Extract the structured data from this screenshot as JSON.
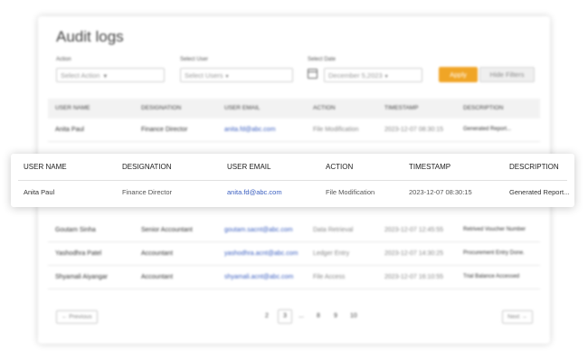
{
  "page": {
    "title": "Audit logs",
    "filters": {
      "action_label": "Action",
      "action_placeholder": "Select Action",
      "user_label": "Select User",
      "user_placeholder": "Select Users",
      "date_label": "Select Date",
      "date_value": "December 5,2023"
    },
    "buttons": {
      "apply": "Apply",
      "hide_filters": "Hide Filters"
    }
  },
  "table": {
    "columns": [
      "USER NAME",
      "DESIGNATION",
      "USER EMAIL",
      "ACTION",
      "TIMESTAMP",
      "DESCRIPTION"
    ],
    "rows": [
      {
        "name": "Anita Paul",
        "designation": "Finance Director",
        "email": "anita.fd@abc.com",
        "action": "File Modification",
        "timestamp": "2023-12-07 08:30:15",
        "description": "Generated Report..."
      },
      {
        "name": "Goutam Sinha",
        "designation": "Senior Accountant",
        "email": "goutam.sacnt@abc.com",
        "action": "Data Retrieval",
        "timestamp": "2023-12-07 12:45:55",
        "description": "Retrived Voucher Number"
      },
      {
        "name": "Yashodhra Patel",
        "designation": "Accountant",
        "email": "yashodhra.acnt@abc.com",
        "action": "Ledger Entry",
        "timestamp": "2023-12-07 14:30:25",
        "description": "Procurement Entry Done."
      },
      {
        "name": "Shyamali Aiyangar",
        "designation": "Accountant",
        "email": "shyamali.acnt@abc.com",
        "action": "File Access",
        "timestamp": "2023-12-07 16:10:55",
        "description": "Trial Balance Accessed"
      }
    ]
  },
  "pagination": {
    "prev": "← Previous",
    "next": "Next →",
    "pages": [
      "2",
      "3",
      "...",
      "8",
      "9",
      "10"
    ]
  },
  "focus": {
    "columns": [
      "USER NAME",
      "DESIGNATION",
      "USER EMAIL",
      "ACTION",
      "TIMESTAMP",
      "DESCRIPTION"
    ],
    "row": {
      "name": "Anita Paul",
      "designation": "Finance Director",
      "email": "anita.fd@abc.com",
      "action": "File Modification",
      "timestamp": "2023-12-07 08:30:15",
      "description": "Generated Report..."
    }
  },
  "colors": {
    "accent": "#f0a526",
    "link": "#3b5fc0"
  }
}
